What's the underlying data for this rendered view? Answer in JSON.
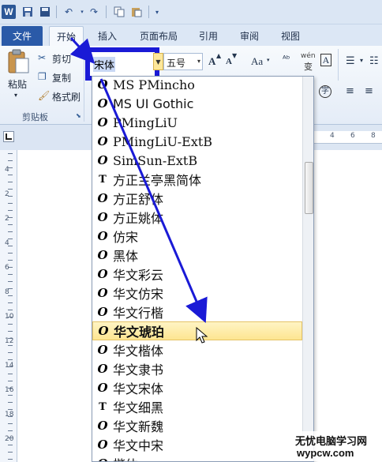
{
  "qat": {
    "logo": "W",
    "save_icon": "save-icon",
    "undo_icon": "undo-icon",
    "redo_icon": "redo-icon"
  },
  "tabs": [
    {
      "label": "文件"
    },
    {
      "label": "开始"
    },
    {
      "label": "插入"
    },
    {
      "label": "页面布局"
    },
    {
      "label": "引用"
    },
    {
      "label": "审阅"
    },
    {
      "label": "视图"
    }
  ],
  "ribbon": {
    "paste": "粘贴",
    "cut": "剪切",
    "copy": "复制",
    "format_painter": "格式刷",
    "clipboard_group": "剪贴板",
    "font_combo_value": "宋体",
    "size_combo_value": "五号",
    "grow_font": "A",
    "shrink_font": "A",
    "change_case": "Aa",
    "phonetic": "wén",
    "char_border": "A"
  },
  "ruler": {
    "h_numbers": [
      "4",
      "6",
      "8"
    ],
    "v_numbers": [
      "4",
      "2",
      "2",
      "4",
      "6",
      "8",
      "10",
      "12",
      "14",
      "16",
      "18",
      "20"
    ]
  },
  "font_list": [
    {
      "name": "MS PMincho",
      "icon": "O"
    },
    {
      "name": "MS UI Gothic",
      "icon": "O"
    },
    {
      "name": "PMingLiU",
      "icon": "O"
    },
    {
      "name": "PMingLiU-ExtB",
      "icon": "O"
    },
    {
      "name": "SimSun-ExtB",
      "icon": "O"
    },
    {
      "name": "方正兰亭黑简体",
      "icon": "T"
    },
    {
      "name": "方正舒体",
      "icon": "O"
    },
    {
      "name": "方正姚体",
      "icon": "O"
    },
    {
      "name": "仿宋",
      "icon": "O"
    },
    {
      "name": "黑体",
      "icon": "O"
    },
    {
      "name": "华文彩云",
      "icon": "O"
    },
    {
      "name": "华文仿宋",
      "icon": "O"
    },
    {
      "name": "华文行楷",
      "icon": "O"
    },
    {
      "name": "华文琥珀",
      "icon": "O"
    },
    {
      "name": "华文楷体",
      "icon": "O"
    },
    {
      "name": "华文隶书",
      "icon": "O"
    },
    {
      "name": "华文宋体",
      "icon": "O"
    },
    {
      "name": "华文细黑",
      "icon": "T"
    },
    {
      "name": "华文新魏",
      "icon": "O"
    },
    {
      "name": "华文中宋",
      "icon": "O"
    },
    {
      "name": "楷体",
      "icon": "O"
    }
  ],
  "selected_font_index": 13,
  "annotation_color": "#1a1ad6",
  "watermark": {
    "line1": "无忧电脑学习网",
    "line2": "wypcw.com"
  }
}
